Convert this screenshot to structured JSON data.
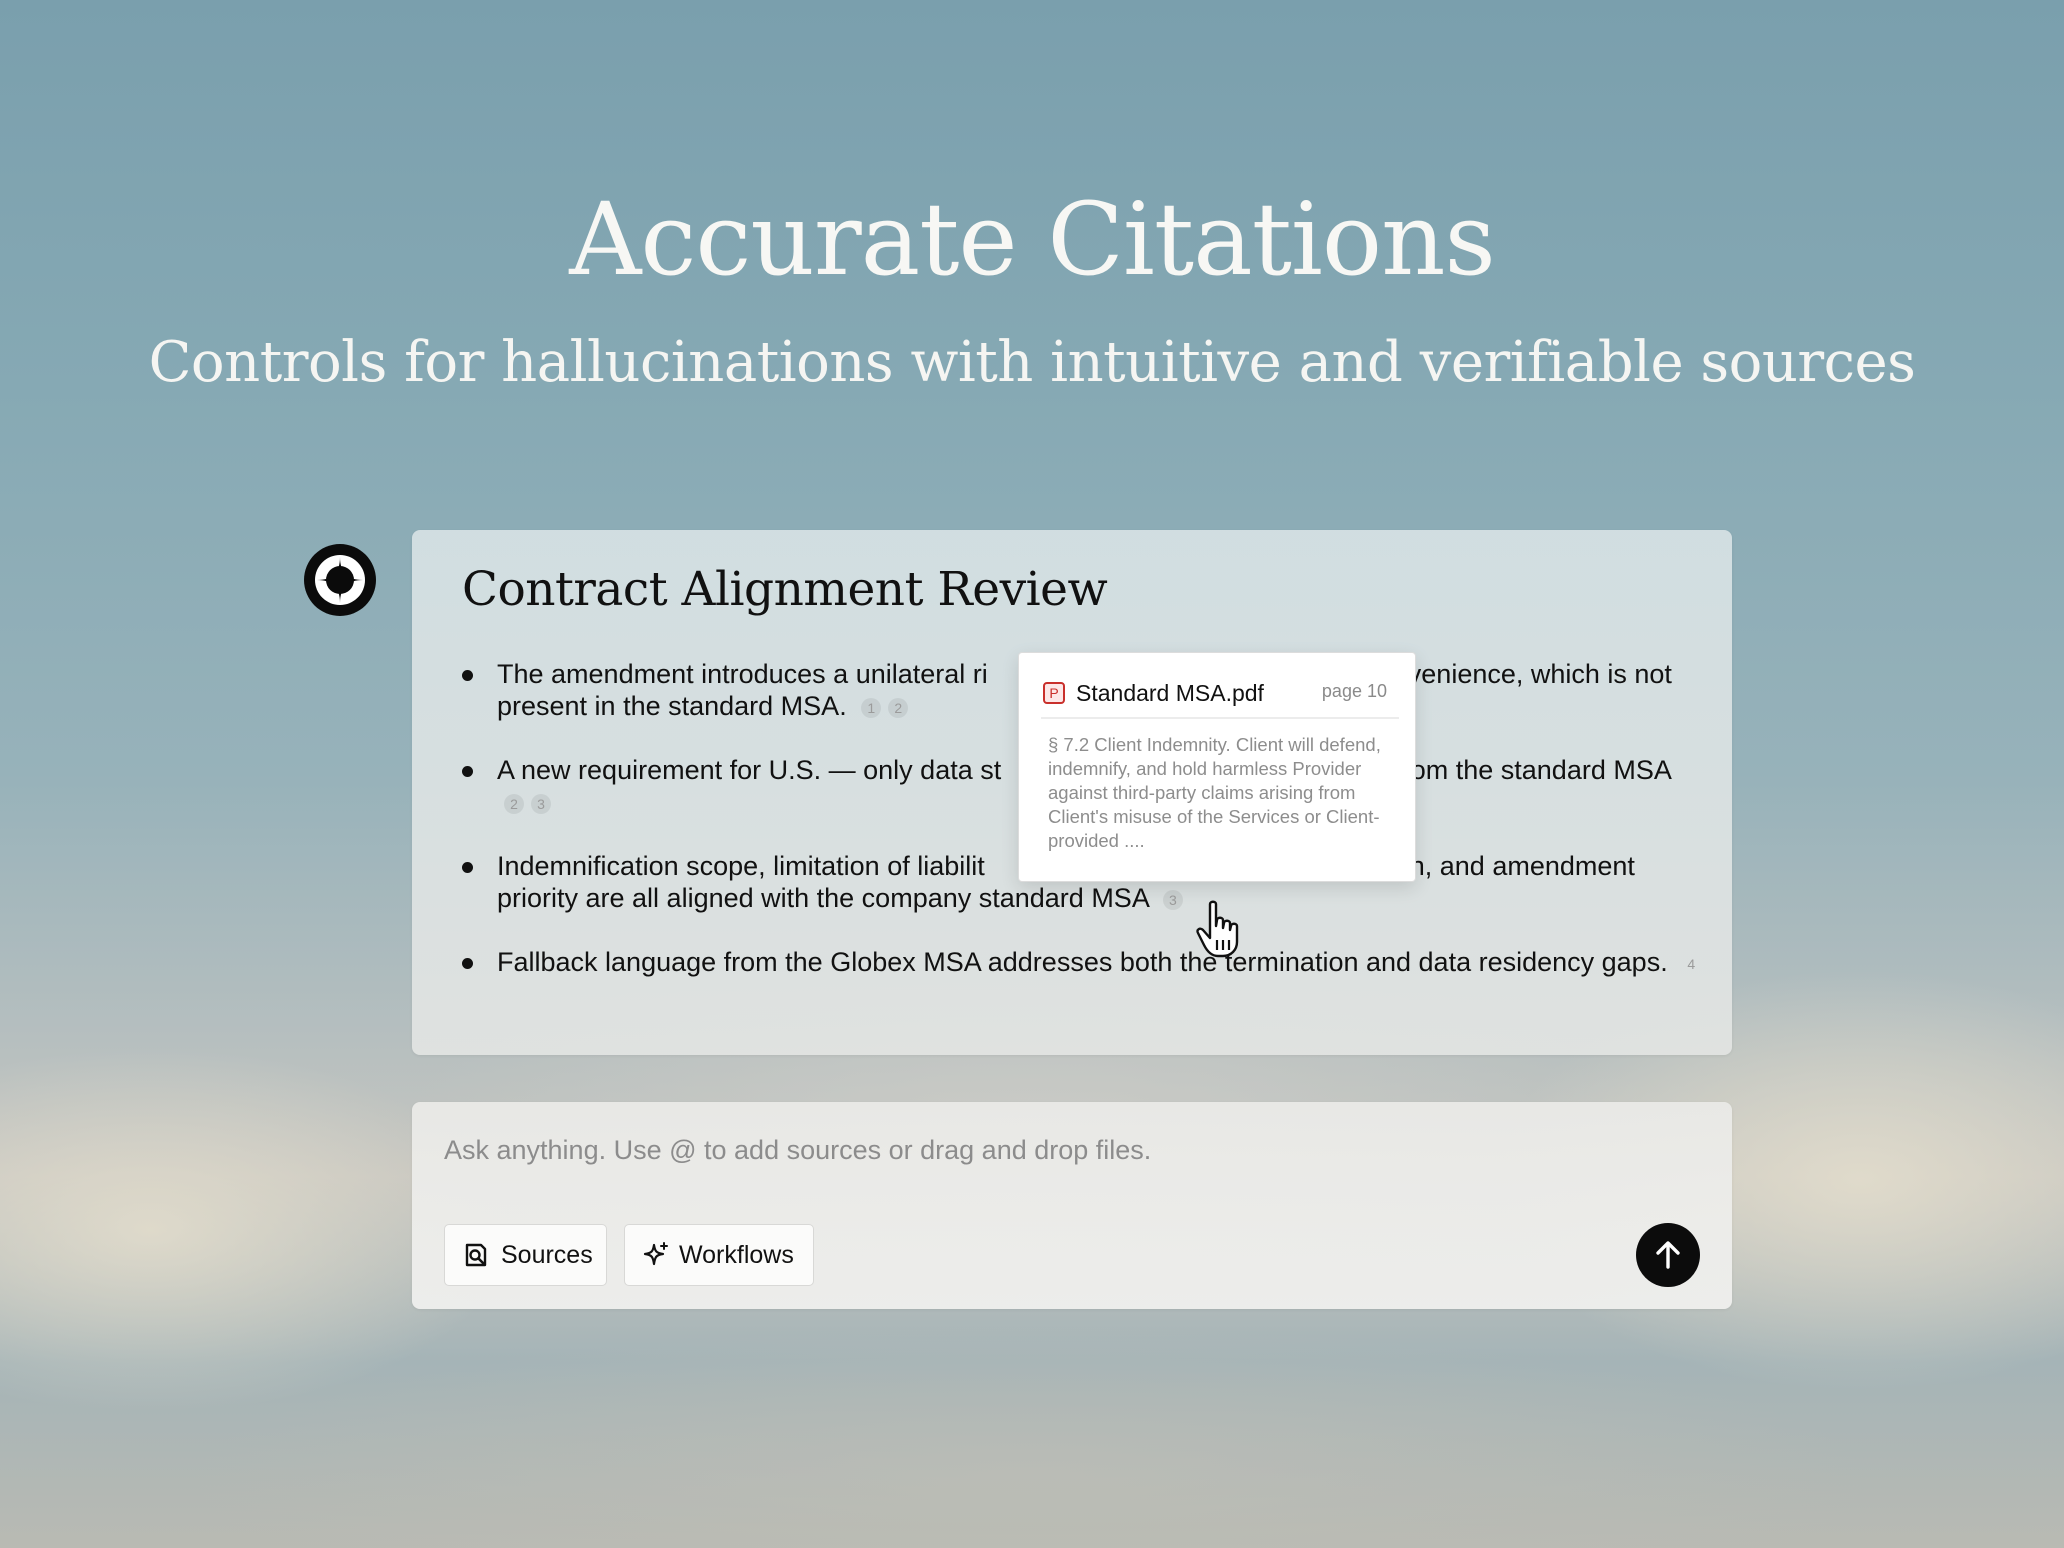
{
  "hero": {
    "title": "Accurate Citations",
    "subtitle": "Controls for hallucinations with intuitive and verifiable sources"
  },
  "review": {
    "title": "Contract Alignment Review",
    "bullets": [
      {
        "text_before": "The amendment introduces a unilateral ri",
        "text_after": "r convenience, which is not present in the standard MSA.",
        "citations": [
          "1",
          "2"
        ]
      },
      {
        "text_before": "A new requirement for U.S. — only data st",
        "text_after": "t from the standard MSA",
        "citations": [
          "2",
          "3"
        ]
      },
      {
        "text_before": "Indemnification scope, limitation of liabilit",
        "text_after": "n, and amendment priority are all aligned with the company standard MSA",
        "citations": [
          "3"
        ]
      },
      {
        "text": "Fallback language from the Globex MSA addresses both the termination and data residency gaps.",
        "citations": [
          "4"
        ]
      }
    ]
  },
  "citation_popover": {
    "file_name": "Standard MSA.pdf",
    "file_type_icon": "pdf-icon",
    "icon_letter": "P",
    "page": "page 10",
    "excerpt": "§ 7.2 Client Indemnity. Client will defend, indemnify, and hold harmless Provider against third-party claims arising from Client's misuse of the Services or Client-provided ...."
  },
  "composer": {
    "placeholder": "Ask anything. Use @ to add sources or drag and drop files.",
    "sources_label": "Sources",
    "workflows_label": "Workflows",
    "send_icon": "arrow-up-icon"
  },
  "colors": {
    "text_dark": "#111111",
    "send_button": "#0c0c0c",
    "pdf_accent": "#c9302c"
  }
}
